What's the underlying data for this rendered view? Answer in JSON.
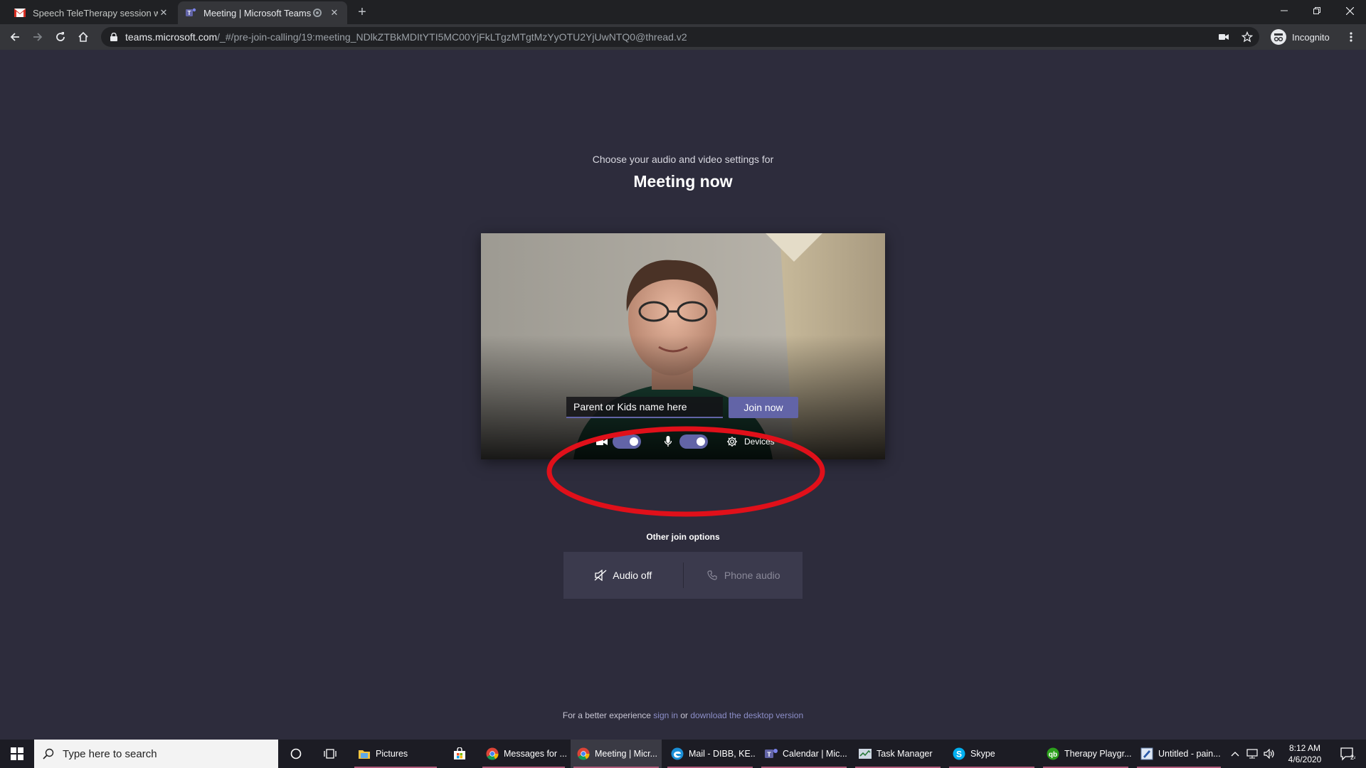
{
  "browser": {
    "tabs": [
      {
        "title": "Speech TeleTherapy session with",
        "favicon": "gmail-icon",
        "active": false
      },
      {
        "title": "Meeting | Microsoft Teams",
        "favicon": "teams-icon",
        "active": true
      }
    ],
    "url_host": "teams.microsoft.com",
    "url_path": "/_#/pre-join-calling/19:meeting_NDlkZTBkMDItYTI5MC00YjFkLTgzMTgtMzYyOTU2YjUwNTQ0@thread.v2",
    "profile_label": "Incognito"
  },
  "prejoin": {
    "subtitle": "Choose your audio and video settings for",
    "meeting_title": "Meeting now",
    "name_placeholder": "Parent or Kids name here",
    "join_label": "Join now",
    "camera_on": true,
    "mic_on": true,
    "devices_label": "Devices",
    "other_options_label": "Other join options",
    "audio_off_label": "Audio off",
    "phone_audio_label": "Phone audio",
    "annotation_color": "#e0101a",
    "accent_color": "#6264a7"
  },
  "footer": {
    "prefix": "For a better experience",
    "sign_in": "sign in",
    "or": "or",
    "download": "download the desktop version"
  },
  "taskbar": {
    "search_placeholder": "Type here to search",
    "apps": [
      {
        "label": "Pictures",
        "icon": "folder-icon"
      },
      {
        "label": "Messages for ...",
        "icon": "chrome-icon"
      },
      {
        "label": "Meeting | Micr...",
        "icon": "chrome-icon"
      },
      {
        "label": "Mail - DIBB, KE...",
        "icon": "edge-icon"
      },
      {
        "label": "Calendar | Mic...",
        "icon": "teams-icon"
      },
      {
        "label": "Task Manager",
        "icon": "task-manager-icon"
      },
      {
        "label": "Skype",
        "icon": "skype-icon"
      },
      {
        "label": "Therapy Playgr...",
        "icon": "quickbooks-icon"
      },
      {
        "label": "Untitled - pain...",
        "icon": "paint-icon"
      }
    ],
    "time": "8:12 AM",
    "date": "4/6/2020",
    "notification_count": "24"
  }
}
